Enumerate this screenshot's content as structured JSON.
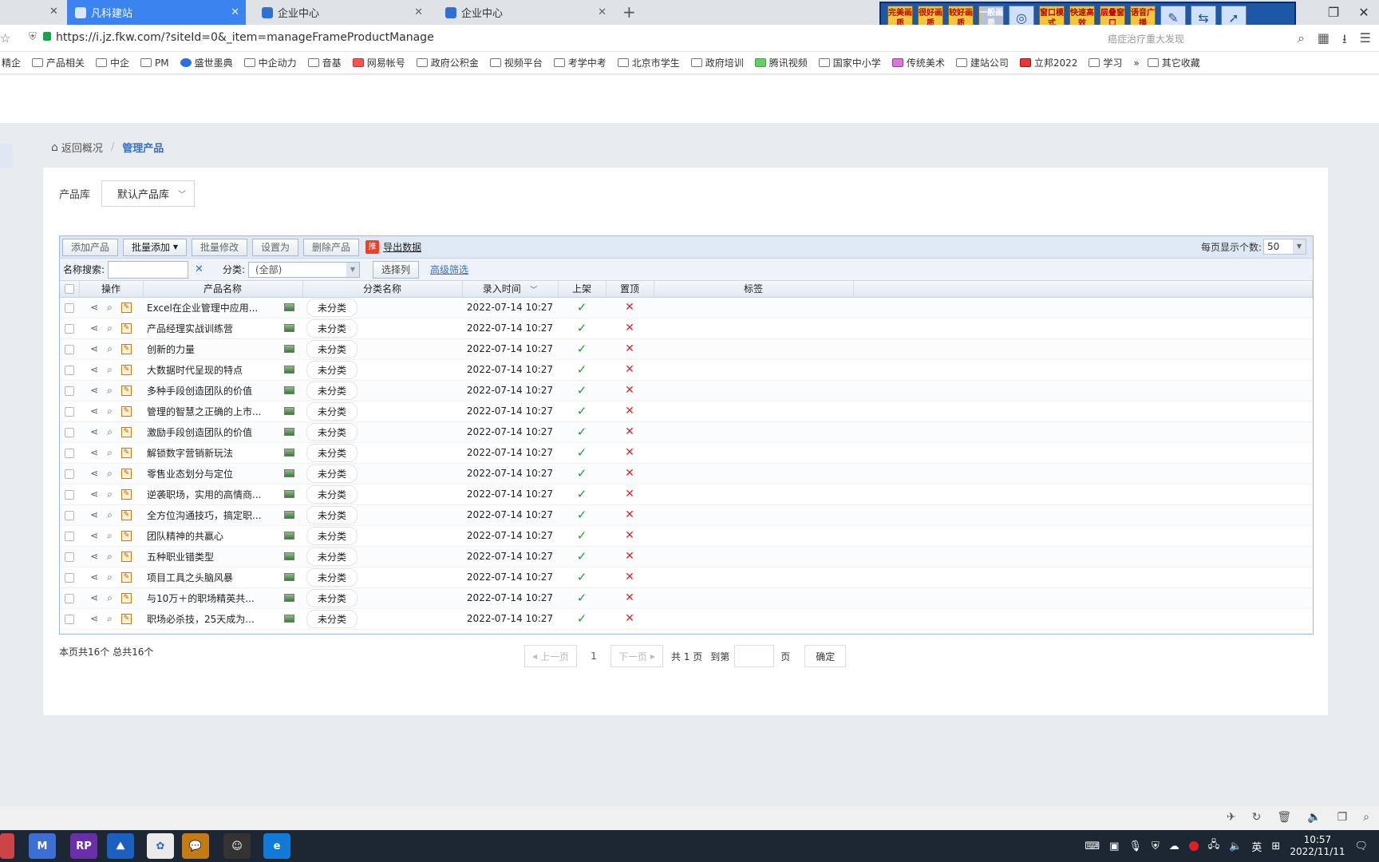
{
  "browser": {
    "tabs": [
      {
        "label": "凡科建站",
        "active": true
      },
      {
        "label": "企业中心",
        "active": false
      },
      {
        "label": "企业中心",
        "active": false
      }
    ],
    "new_tab_symbol": "+",
    "url": "https://i.jz.fkw.com/?siteId=0&_item=manageFrameProductManage",
    "search_hint": "癌症治疗重大发现",
    "overlay_buttons": [
      "完美画质",
      "很好画质",
      "较好画质",
      "一般画质",
      "窗口模式",
      "快速高效",
      "层叠窗口",
      "语音广播"
    ],
    "bookmarks": [
      "精企",
      "产品相关",
      "中企",
      "PM",
      "盛世墨典",
      "中企动力",
      "音基",
      "网易帐号",
      "政府公积金",
      "视频平台",
      "考学中考",
      "北京市学生",
      "政府培训",
      "腾讯视频",
      "国家中小学",
      "传统美术",
      "建站公司",
      "立邦2022",
      "学习",
      "其它收藏"
    ]
  },
  "breadcrumb": {
    "back": "返回概况",
    "current": "管理产品"
  },
  "library": {
    "label": "产品库",
    "selected": "默认产品库"
  },
  "grid_toolbar": {
    "add": "添加产品",
    "batch_add": "批量添加",
    "batch_edit": "批量修改",
    "set_as": "设置为",
    "delete": "删除产品",
    "export_icon_text": "推",
    "export": "导出数据",
    "per_page_label": "每页显示个数:",
    "per_page_value": "50"
  },
  "filter": {
    "name_label": "名称搜索:",
    "category_label": "分类:",
    "category_value": "(全部)",
    "choose_columns": "选择列",
    "advanced": "高级筛选"
  },
  "columns": {
    "ops": "操作",
    "name": "产品名称",
    "category": "分类名称",
    "time": "录入时间",
    "onshelf": "上架",
    "top": "置顶",
    "tags": "标签"
  },
  "rows": [
    {
      "name": "Excel在企业管理中应用...",
      "category": "未分类",
      "time": "2022-07-14 10:27",
      "onshelf": true,
      "top": false
    },
    {
      "name": "产品经理实战训练营",
      "category": "未分类",
      "time": "2022-07-14 10:27",
      "onshelf": true,
      "top": false
    },
    {
      "name": "创新的力量",
      "category": "未分类",
      "time": "2022-07-14 10:27",
      "onshelf": true,
      "top": false
    },
    {
      "name": "大数据时代呈现的特点",
      "category": "未分类",
      "time": "2022-07-14 10:27",
      "onshelf": true,
      "top": false
    },
    {
      "name": "多种手段创造团队的价值",
      "category": "未分类",
      "time": "2022-07-14 10:27",
      "onshelf": true,
      "top": false
    },
    {
      "name": "管理的智慧之正确的上市...",
      "category": "未分类",
      "time": "2022-07-14 10:27",
      "onshelf": true,
      "top": false
    },
    {
      "name": "激励手段创造团队的价值",
      "category": "未分类",
      "time": "2022-07-14 10:27",
      "onshelf": true,
      "top": false
    },
    {
      "name": "解锁数字营销新玩法",
      "category": "未分类",
      "time": "2022-07-14 10:27",
      "onshelf": true,
      "top": false
    },
    {
      "name": "零售业态划分与定位",
      "category": "未分类",
      "time": "2022-07-14 10:27",
      "onshelf": true,
      "top": false
    },
    {
      "name": "逆袭职场，实用的高情商...",
      "category": "未分类",
      "time": "2022-07-14 10:27",
      "onshelf": true,
      "top": false
    },
    {
      "name": "全方位沟通技巧，搞定职...",
      "category": "未分类",
      "time": "2022-07-14 10:27",
      "onshelf": true,
      "top": false
    },
    {
      "name": "团队精神的共赢心",
      "category": "未分类",
      "time": "2022-07-14 10:27",
      "onshelf": true,
      "top": false
    },
    {
      "name": "五种职业错类型",
      "category": "未分类",
      "time": "2022-07-14 10:27",
      "onshelf": true,
      "top": false
    },
    {
      "name": "项目工具之头脑风暴",
      "category": "未分类",
      "time": "2022-07-14 10:27",
      "onshelf": true,
      "top": false
    },
    {
      "name": "与10万＋的职场精英共...",
      "category": "未分类",
      "time": "2022-07-14 10:27",
      "onshelf": true,
      "top": false
    },
    {
      "name": "职场必杀技，25天成为...",
      "category": "未分类",
      "time": "2022-07-14 10:27",
      "onshelf": true,
      "top": false
    }
  ],
  "pager": {
    "summary": "本页共16个 总共16个",
    "prev": "上一页",
    "current": "1",
    "next": "下一页",
    "total": "共 1 页",
    "goto": "到第",
    "page_unit": "页",
    "confirm": "确定"
  },
  "taskbar": {
    "ime": "英",
    "time": "10:57",
    "date": "2022/11/11"
  },
  "colors": {
    "accent": "#3a6fc4",
    "tab_active": "#3b84f0",
    "check": "#219a2a",
    "cross": "#d3272f"
  }
}
